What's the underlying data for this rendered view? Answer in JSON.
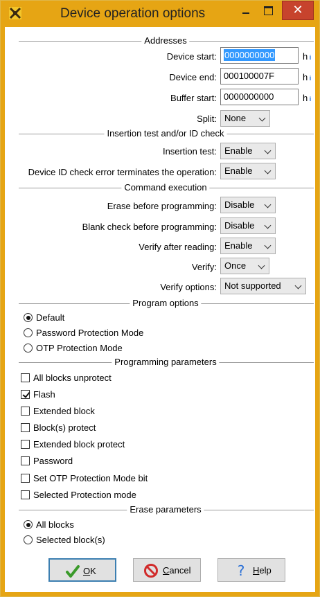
{
  "window": {
    "title": "Device operation options"
  },
  "colors": {
    "titlebar": "#e6a514",
    "close": "#c7432d",
    "selection": "#3399ff"
  },
  "sections": {
    "addresses": "Addresses",
    "insertion": "Insertion test and/or ID check",
    "command": "Command execution",
    "program": "Program options",
    "programming_params": "Programming parameters",
    "erase": "Erase parameters"
  },
  "addresses": {
    "device_start": {
      "label": "Device start:",
      "value": "0000000000",
      "suffix": "h"
    },
    "device_end": {
      "label": "Device end:",
      "value": "000100007F",
      "suffix": "h"
    },
    "buffer_start": {
      "label": "Buffer start:",
      "value": "0000000000",
      "suffix": "h"
    },
    "split": {
      "label": "Split:",
      "value": "None"
    }
  },
  "insertion": {
    "insertion_test": {
      "label": "Insertion test:",
      "value": "Enable"
    },
    "id_check": {
      "label": "Device ID check error terminates the operation:",
      "value": "Enable"
    }
  },
  "command": {
    "erase_before": {
      "label": "Erase before programming:",
      "value": "Disable"
    },
    "blank_check": {
      "label": "Blank check before programming:",
      "value": "Disable"
    },
    "verify_after_reading": {
      "label": "Verify after reading:",
      "value": "Enable"
    },
    "verify": {
      "label": "Verify:",
      "value": "Once"
    },
    "verify_options": {
      "label": "Verify options:",
      "value": "Not supported"
    }
  },
  "program_options": [
    {
      "label": "Default",
      "selected": true
    },
    {
      "label": "Password Protection Mode",
      "selected": false
    },
    {
      "label": "OTP Protection Mode",
      "selected": false
    }
  ],
  "programming_params": [
    {
      "label": "All blocks unprotect",
      "checked": false
    },
    {
      "label": "Flash",
      "checked": true
    },
    {
      "label": "Extended block",
      "checked": false
    },
    {
      "label": "Block(s) protect",
      "checked": false
    },
    {
      "label": "Extended block protect",
      "checked": false
    },
    {
      "label": "Password",
      "checked": false
    },
    {
      "label": "Set OTP Protection Mode bit",
      "checked": false
    },
    {
      "label": "Selected Protection mode",
      "checked": false
    }
  ],
  "erase_params": [
    {
      "label": "All blocks",
      "selected": true
    },
    {
      "label": "Selected block(s)",
      "selected": false
    }
  ],
  "buttons": {
    "ok": "OK",
    "cancel": "Cancel",
    "help": "Help"
  }
}
